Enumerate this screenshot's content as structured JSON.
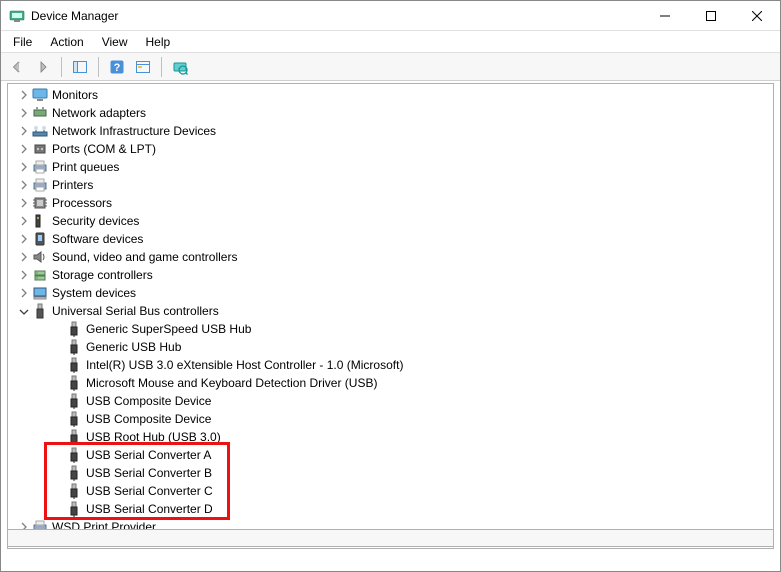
{
  "window": {
    "title": "Device Manager"
  },
  "menu": {
    "file": "File",
    "action": "Action",
    "view": "View",
    "help": "Help"
  },
  "toolbar": {
    "back": "back-arrow-icon",
    "forward": "forward-arrow-icon",
    "show_hide_tree": "console-tree-icon",
    "help": "help-icon",
    "props": "properties-icon",
    "scan": "scan-hardware-icon"
  },
  "tree": {
    "nodes": [
      {
        "label": "Monitors",
        "icon": "monitor-icon",
        "expanded": false,
        "level": 0
      },
      {
        "label": "Network adapters",
        "icon": "network-adapter-icon",
        "expanded": false,
        "level": 0
      },
      {
        "label": "Network Infrastructure Devices",
        "icon": "network-infra-icon",
        "expanded": false,
        "level": 0
      },
      {
        "label": "Ports (COM & LPT)",
        "icon": "port-icon",
        "expanded": false,
        "level": 0
      },
      {
        "label": "Print queues",
        "icon": "printer-icon",
        "expanded": false,
        "level": 0
      },
      {
        "label": "Printers",
        "icon": "printer-icon",
        "expanded": false,
        "level": 0
      },
      {
        "label": "Processors",
        "icon": "cpu-icon",
        "expanded": false,
        "level": 0
      },
      {
        "label": "Security devices",
        "icon": "security-icon",
        "expanded": false,
        "level": 0
      },
      {
        "label": "Software devices",
        "icon": "software-device-icon",
        "expanded": false,
        "level": 0
      },
      {
        "label": "Sound, video and game controllers",
        "icon": "sound-icon",
        "expanded": false,
        "level": 0
      },
      {
        "label": "Storage controllers",
        "icon": "storage-icon",
        "expanded": false,
        "level": 0
      },
      {
        "label": "System devices",
        "icon": "system-icon",
        "expanded": false,
        "level": 0
      },
      {
        "label": "Universal Serial Bus controllers",
        "icon": "usb-icon",
        "expanded": true,
        "level": 0
      },
      {
        "label": "Generic SuperSpeed USB Hub",
        "icon": "usb-plug-icon",
        "expanded": null,
        "level": 1
      },
      {
        "label": "Generic USB Hub",
        "icon": "usb-plug-icon",
        "expanded": null,
        "level": 1
      },
      {
        "label": "Intel(R) USB 3.0 eXtensible Host Controller - 1.0 (Microsoft)",
        "icon": "usb-plug-icon",
        "expanded": null,
        "level": 1
      },
      {
        "label": "Microsoft Mouse and Keyboard Detection Driver (USB)",
        "icon": "usb-plug-icon",
        "expanded": null,
        "level": 1
      },
      {
        "label": "USB Composite Device",
        "icon": "usb-plug-icon",
        "expanded": null,
        "level": 1
      },
      {
        "label": "USB Composite Device",
        "icon": "usb-plug-icon",
        "expanded": null,
        "level": 1
      },
      {
        "label": "USB Root Hub (USB 3.0)",
        "icon": "usb-plug-icon",
        "expanded": null,
        "level": 1
      },
      {
        "label": "USB Serial Converter A",
        "icon": "usb-plug-icon",
        "expanded": null,
        "level": 1,
        "highlighted": true
      },
      {
        "label": "USB Serial Converter B",
        "icon": "usb-plug-icon",
        "expanded": null,
        "level": 1,
        "highlighted": true
      },
      {
        "label": "USB Serial Converter C",
        "icon": "usb-plug-icon",
        "expanded": null,
        "level": 1,
        "highlighted": true
      },
      {
        "label": "USB Serial Converter D",
        "icon": "usb-plug-icon",
        "expanded": null,
        "level": 1,
        "highlighted": true
      },
      {
        "label": "WSD Print Provider",
        "icon": "printer-icon",
        "expanded": false,
        "level": 0
      }
    ]
  }
}
